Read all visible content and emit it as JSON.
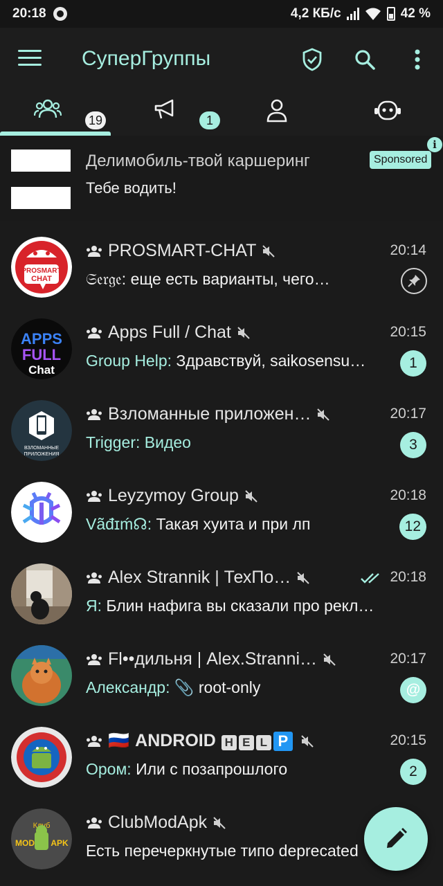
{
  "statusbar": {
    "time": "20:18",
    "speed": "4,2 КБ/с",
    "battery": "42 %"
  },
  "app": {
    "title": "СуперГруппы",
    "accent": "#a6eee0",
    "background": "#1b1b1b"
  },
  "tabs": [
    {
      "icon": "groups-icon",
      "badge": "19"
    },
    {
      "icon": "megaphone-icon",
      "badge": "1"
    },
    {
      "icon": "person-icon"
    },
    {
      "icon": "bot-icon"
    }
  ],
  "ad": {
    "title": "Делимобиль-твой каршеринг",
    "subtitle": "Тебе водить!",
    "sponsored": "Sponsored",
    "info": "i"
  },
  "chats": [
    {
      "name": "PROSMART-CHAT",
      "time": "20:14",
      "sender": "𝔖𝔢𝔯𝔤𝔢:",
      "message": " еще есть варианты, чего…",
      "pinned": true,
      "muted": true
    },
    {
      "name": "Apps Full / Chat",
      "time": "20:15",
      "sender": "Group Help:",
      "message": " Здравствуй, saikosensu…",
      "badge": "1",
      "muted": true
    },
    {
      "name": "Взломанные приложен…",
      "time": "20:17",
      "sender": "Trigger: Видео",
      "message": "",
      "badge": "3",
      "muted": true
    },
    {
      "name": "Leyzymoy Group",
      "time": "20:18",
      "sender": "Vãđɪḿ☊:",
      "message": " Такая хуита и при лп",
      "badge": "12",
      "muted": true
    },
    {
      "name": "Alex Strannik | ТехПо…",
      "time": "20:18",
      "sender": "Я:",
      "message": " Блин нафига вы сказали про рекл…",
      "read": true,
      "muted": true
    },
    {
      "name": "Fl••дильня | Alex.Stranni…",
      "time": "20:17",
      "sender": "Александр:",
      "message": " 📎 root-only",
      "mention": "@",
      "muted": true
    },
    {
      "name_flag": "🇷🇺",
      "name": "ANDROID",
      "name_help": [
        "H",
        "E",
        "L",
        "P"
      ],
      "time": "20:15",
      "sender": "Ором:",
      "message": " Или с позапрошлого",
      "badge": "2",
      "muted": true
    },
    {
      "name": "ClubModApk",
      "time": "",
      "sender": "",
      "message": "Есть перечеркнутые типо deprecated",
      "muted": true
    }
  ]
}
